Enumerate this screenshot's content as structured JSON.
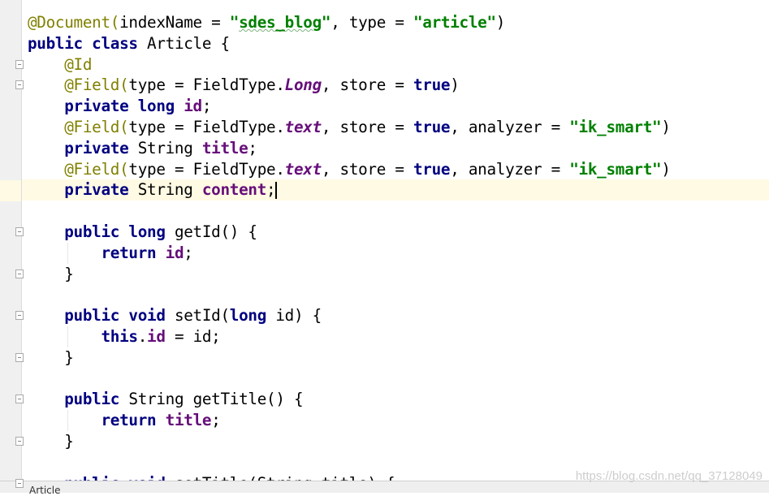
{
  "editor": {
    "current_line": 8,
    "lines": [
      [
        [
          "ann",
          "@Document("
        ],
        [
          "plain",
          "indexName = "
        ],
        [
          "str",
          "\""
        ],
        [
          "strsq",
          "sdes_blog"
        ],
        [
          "str",
          "\""
        ],
        [
          "plain",
          ", type = "
        ],
        [
          "str",
          "\"article\""
        ],
        [
          "plain",
          ")"
        ]
      ],
      [
        [
          "kw",
          "public class "
        ],
        [
          "plain",
          "Article {"
        ]
      ],
      [
        [
          "plain",
          "    "
        ],
        [
          "ann",
          "@Id"
        ]
      ],
      [
        [
          "plain",
          "    "
        ],
        [
          "ann",
          "@Field("
        ],
        [
          "plain",
          "type = FieldType."
        ],
        [
          "static",
          "Long"
        ],
        [
          "plain",
          ", store = "
        ],
        [
          "kw",
          "true"
        ],
        [
          "plain",
          ")"
        ]
      ],
      [
        [
          "plain",
          "    "
        ],
        [
          "kw",
          "private long "
        ],
        [
          "field",
          "id"
        ],
        [
          "plain",
          ";"
        ]
      ],
      [
        [
          "plain",
          "    "
        ],
        [
          "ann",
          "@Field("
        ],
        [
          "plain",
          "type = FieldType."
        ],
        [
          "static",
          "text"
        ],
        [
          "plain",
          ", store = "
        ],
        [
          "kw",
          "true"
        ],
        [
          "plain",
          ", analyzer = "
        ],
        [
          "str",
          "\"ik_smart\""
        ],
        [
          "plain",
          ")"
        ]
      ],
      [
        [
          "plain",
          "    "
        ],
        [
          "kw",
          "private "
        ],
        [
          "plain",
          "String "
        ],
        [
          "field",
          "title"
        ],
        [
          "plain",
          ";"
        ]
      ],
      [
        [
          "plain",
          "    "
        ],
        [
          "ann",
          "@Field("
        ],
        [
          "plain",
          "type = FieldType."
        ],
        [
          "static",
          "text"
        ],
        [
          "plain",
          ", store = "
        ],
        [
          "kw",
          "true"
        ],
        [
          "plain",
          ", analyzer = "
        ],
        [
          "str",
          "\"ik_smart\""
        ],
        [
          "plain",
          ")"
        ]
      ],
      [
        [
          "plain",
          "    "
        ],
        [
          "kw",
          "private "
        ],
        [
          "plain",
          "String "
        ],
        [
          "field",
          "content"
        ],
        [
          "plain",
          ";"
        ],
        [
          "caret",
          ""
        ]
      ],
      [],
      [
        [
          "plain",
          "    "
        ],
        [
          "kw",
          "public long "
        ],
        [
          "plain",
          "getId() {"
        ]
      ],
      [
        [
          "plain",
          "        "
        ],
        [
          "kw",
          "return "
        ],
        [
          "field",
          "id"
        ],
        [
          "plain",
          ";"
        ]
      ],
      [
        [
          "plain",
          "    }"
        ]
      ],
      [],
      [
        [
          "plain",
          "    "
        ],
        [
          "kw",
          "public void "
        ],
        [
          "plain",
          "setId("
        ],
        [
          "kw",
          "long "
        ],
        [
          "plain",
          "id) {"
        ]
      ],
      [
        [
          "plain",
          "        "
        ],
        [
          "kw",
          "this"
        ],
        [
          "plain",
          "."
        ],
        [
          "field",
          "id"
        ],
        [
          "plain",
          " = id;"
        ]
      ],
      [
        [
          "plain",
          "    }"
        ]
      ],
      [],
      [
        [
          "plain",
          "    "
        ],
        [
          "kw",
          "public "
        ],
        [
          "plain",
          "String getTitle() {"
        ]
      ],
      [
        [
          "plain",
          "        "
        ],
        [
          "kw",
          "return "
        ],
        [
          "field",
          "title"
        ],
        [
          "plain",
          ";"
        ]
      ],
      [
        [
          "plain",
          "    }"
        ]
      ],
      [],
      [
        [
          "plain",
          "    "
        ],
        [
          "kw",
          "public void "
        ],
        [
          "plain",
          "setTitle(String title) {"
        ]
      ]
    ]
  },
  "statusbar": {
    "file_tab": "Article"
  },
  "watermark": "https://blog.csdn.net/qq_37128049",
  "colors": {
    "annotation": "#808000",
    "keyword": "#000080",
    "string": "#008000",
    "field": "#660e7a",
    "current_line": "#fffae3"
  }
}
